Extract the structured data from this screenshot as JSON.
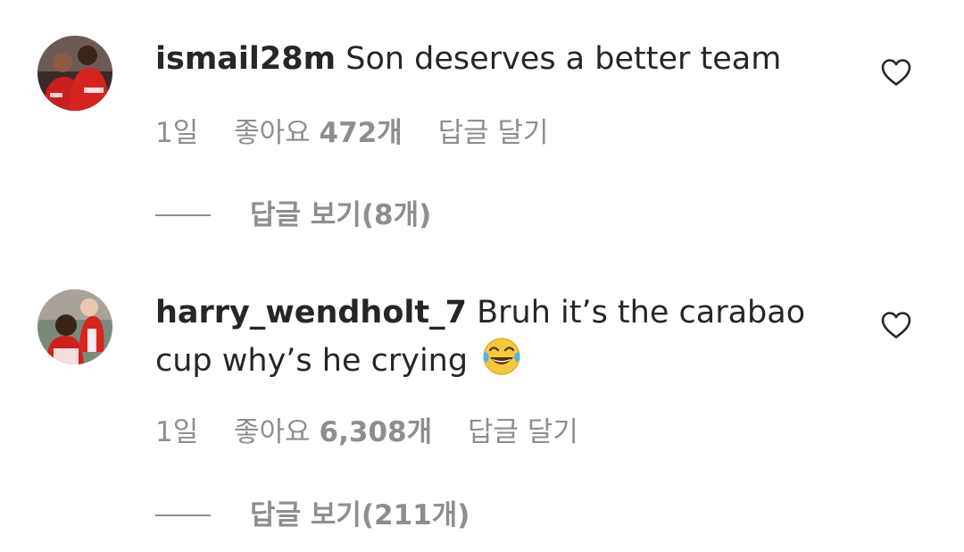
{
  "comments": [
    {
      "avatar_icon": "user-avatar-red-jersey",
      "username": "ismail28m",
      "text": "Son deserves a better team",
      "emoji": "",
      "time": "1일",
      "likes_prefix": "좋아요",
      "likes_count": "472개",
      "reply_label": "답글 달기",
      "view_replies_label": "답글 보기(8개)",
      "like_icon": "heart-outline-icon"
    },
    {
      "avatar_icon": "user-avatar-red-jersey",
      "username": "harry_wendholt_7",
      "text": "Bruh it’s the carabao cup why’s he crying",
      "emoji": "😂",
      "time": "1일",
      "likes_prefix": "좋아요",
      "likes_count": "6,308개",
      "reply_label": "답글 달기",
      "view_replies_label": "답글 보기(211개)",
      "like_icon": "heart-outline-icon"
    }
  ],
  "colors": {
    "text_primary": "#262626",
    "text_secondary": "#8e8e8e",
    "background": "#ffffff"
  }
}
